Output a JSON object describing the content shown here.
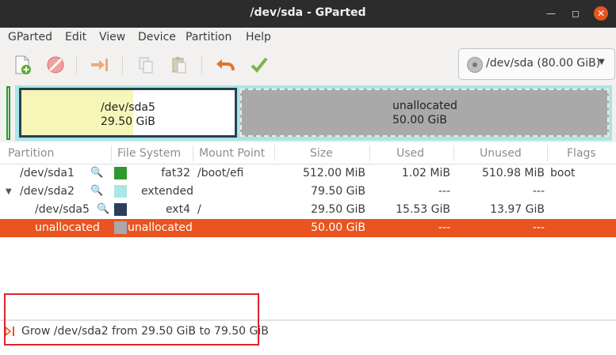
{
  "window": {
    "title": "/dev/sda - GParted"
  },
  "menu": [
    "GParted",
    "Edit",
    "View",
    "Device",
    "Partition",
    "Help"
  ],
  "toolbar": {
    "new": "new-partition-icon",
    "delete": "delete-icon",
    "resize": "resize-move-icon",
    "copy": "copy-icon",
    "paste": "paste-icon",
    "undo": "undo-icon",
    "apply": "apply-icon"
  },
  "device": {
    "label": "/dev/sda (80.00 GiB)"
  },
  "graph": {
    "sda5": {
      "name": "/dev/sda5",
      "size": "29.50 GiB"
    },
    "unallocated": {
      "name": "unallocated",
      "size": "50.00 GiB"
    }
  },
  "columns": [
    "Partition",
    "File System",
    "Mount Point",
    "Size",
    "Used",
    "Unused",
    "Flags"
  ],
  "rows": [
    {
      "partition": "/dev/sda1",
      "fs": "fat32",
      "mount": "/boot/efi",
      "size": "512.00 MiB",
      "used": "1.02 MiB",
      "unused": "510.98 MiB",
      "flags": "boot",
      "color": "#2e9a2e"
    },
    {
      "partition": "/dev/sda2",
      "fs": "extended",
      "mount": "",
      "size": "79.50 GiB",
      "used": "---",
      "unused": "---",
      "flags": "",
      "color": "#a8e7e4"
    },
    {
      "partition": "/dev/sda5",
      "fs": "ext4",
      "mount": "/",
      "size": "29.50 GiB",
      "used": "15.53 GiB",
      "unused": "13.97 GiB",
      "flags": "",
      "color": "#2c3e5a"
    },
    {
      "partition": "unallocated",
      "fs": "unallocated",
      "mount": "",
      "size": "50.00 GiB",
      "used": "---",
      "unused": "---",
      "flags": "",
      "color": "#a9a9a9"
    }
  ],
  "pending": {
    "operation": "Grow /dev/sda2 from 29.50 GiB to 79.50 GiB"
  },
  "colors": {
    "accent": "#e95420",
    "highlight_box": "#d9262c"
  }
}
